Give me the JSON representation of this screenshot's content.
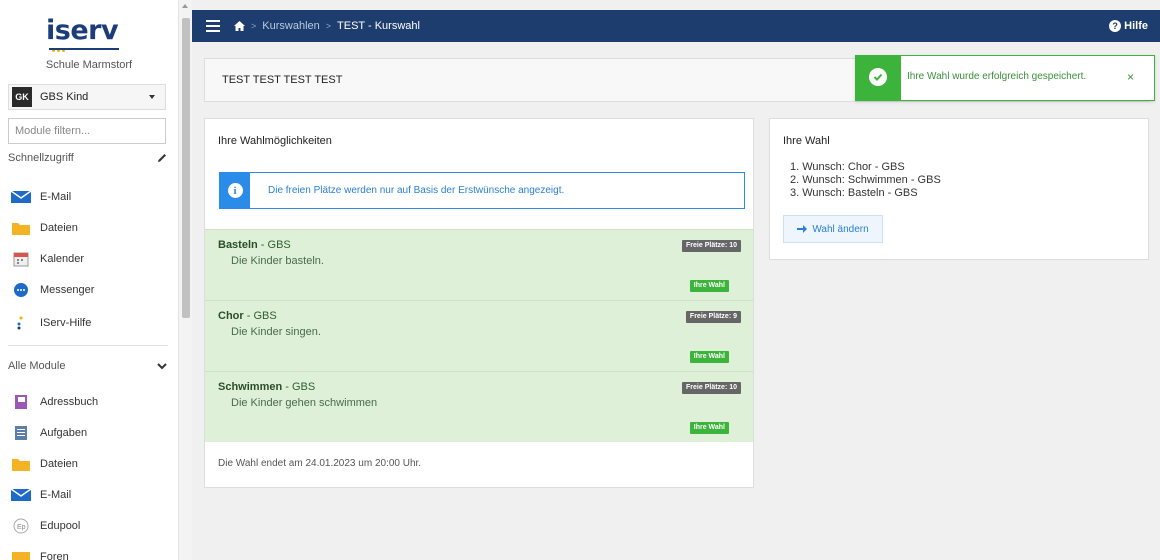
{
  "sidebar": {
    "logo": "iserv",
    "school": "Schule Marmstorf",
    "group": {
      "initials": "GK",
      "name": "GBS Kind"
    },
    "filter_placeholder": "Module filtern...",
    "quick_access_label": "Schnellzugriff",
    "quick_items": [
      {
        "label": "E-Mail",
        "icon": "mail-icon"
      },
      {
        "label": "Dateien",
        "icon": "folder-icon"
      },
      {
        "label": "Kalender",
        "icon": "calendar-icon"
      },
      {
        "label": "Messenger",
        "icon": "chat-icon"
      },
      {
        "label": "IServ-Hilfe",
        "icon": "help-dots-icon"
      }
    ],
    "all_modules_label": "Alle Module",
    "module_items": [
      {
        "label": "Adressbuch",
        "icon": "addressbook-icon"
      },
      {
        "label": "Aufgaben",
        "icon": "tasks-icon"
      },
      {
        "label": "Dateien",
        "icon": "folder-icon"
      },
      {
        "label": "E-Mail",
        "icon": "mail-icon"
      },
      {
        "label": "Edupool",
        "icon": "edupool-icon"
      },
      {
        "label": "Foren",
        "icon": "forum-icon"
      }
    ]
  },
  "topbar": {
    "breadcrumbs": [
      "Kurswahlen",
      "TEST - Kurswahl"
    ],
    "help_label": "Hilfe"
  },
  "page": {
    "title": "TEST TEST TEST TEST"
  },
  "toast": {
    "message": "Ihre Wahl wurde erfolgreich gespeichert.",
    "close": "×"
  },
  "options": {
    "heading": "Ihre Wahlmöglichkeiten",
    "info": "Die freien Plätze werden nur auf Basis der Erstwünsche angezeigt.",
    "courses": [
      {
        "name": "Basteln",
        "group": " - GBS",
        "desc": "Die Kinder basteln.",
        "free": "Freie Plätze: 10",
        "badge": "Ihre Wahl"
      },
      {
        "name": "Chor",
        "group": " - GBS",
        "desc": "Die Kinder singen.",
        "free": "Freie Plätze: 9",
        "badge": "Ihre Wahl"
      },
      {
        "name": "Schwimmen",
        "group": " - GBS",
        "desc": "Die Kinder gehen schwimmen",
        "free": "Freie Plätze: 10",
        "badge": "Ihre Wahl"
      }
    ],
    "deadline": "Die Wahl endet am 24.01.2023 um 20:00 Uhr."
  },
  "choice": {
    "heading": "Ihre Wahl",
    "wishes": [
      "1. Wunsch: Chor - GBS",
      "2. Wunsch: Schwimmen - GBS",
      "3. Wunsch: Basteln - GBS"
    ],
    "change_label": "Wahl ändern"
  },
  "colors": {
    "topbar": "#1c3d6e",
    "success": "#3cb43c",
    "info": "#2a8be8",
    "course_bg": "#dff0d8"
  }
}
